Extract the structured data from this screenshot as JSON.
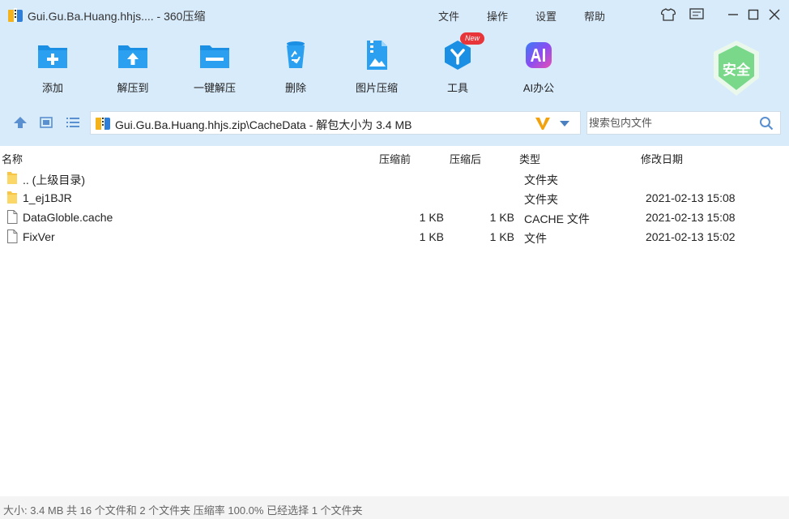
{
  "window": {
    "title": "Gui.Gu.Ba.Huang.hhjs.... - 360压缩",
    "menu": [
      "文件",
      "操作",
      "设置",
      "帮助"
    ]
  },
  "toolbar": {
    "items": [
      {
        "label": "添加",
        "icon": "add-icon"
      },
      {
        "label": "解压到",
        "icon": "extract-to-icon"
      },
      {
        "label": "一键解压",
        "icon": "one-click-extract-icon"
      },
      {
        "label": "删除",
        "icon": "delete-icon"
      },
      {
        "label": "图片压缩",
        "icon": "image-compress-icon"
      },
      {
        "label": "工具",
        "icon": "tools-icon"
      },
      {
        "label": "AI办公",
        "icon": "ai-office-icon"
      }
    ],
    "new_badge": "New",
    "security_label": "安全"
  },
  "navigation": {
    "path": "Gui.Gu.Ba.Huang.hhjs.zip\\CacheData - 解包大小为 3.4 MB",
    "search_placeholder": "搜索包内文件"
  },
  "list": {
    "columns": {
      "name": "名称",
      "packed": "压缩前",
      "unpacked": "压缩后",
      "type": "类型",
      "modified": "修改日期"
    },
    "rows": [
      {
        "name": ".. (上级目录)",
        "packed": "",
        "unpacked": "",
        "type": "文件夹",
        "modified": "",
        "kind": "folder"
      },
      {
        "name": "1_ej1BJR",
        "packed": "",
        "unpacked": "",
        "type": "文件夹",
        "modified": "2021-02-13 15:08",
        "kind": "folder"
      },
      {
        "name": "DataGloble.cache",
        "packed": "1 KB",
        "unpacked": "1 KB",
        "type": "CACHE 文件",
        "modified": "2021-02-13 15:08",
        "kind": "file"
      },
      {
        "name": "FixVer",
        "packed": "1 KB",
        "unpacked": "1 KB",
        "type": "文件",
        "modified": "2021-02-13 15:02",
        "kind": "file"
      }
    ]
  },
  "status": {
    "text": "大小: 3.4 MB 共 16 个文件和 2 个文件夹 压缩率 100.0% 已经选择 1 个文件夹"
  },
  "colors": {
    "header_bg": "#d8ebfb",
    "accent_blue": "#1a8fe3",
    "shield_green": "#7ad88a"
  }
}
